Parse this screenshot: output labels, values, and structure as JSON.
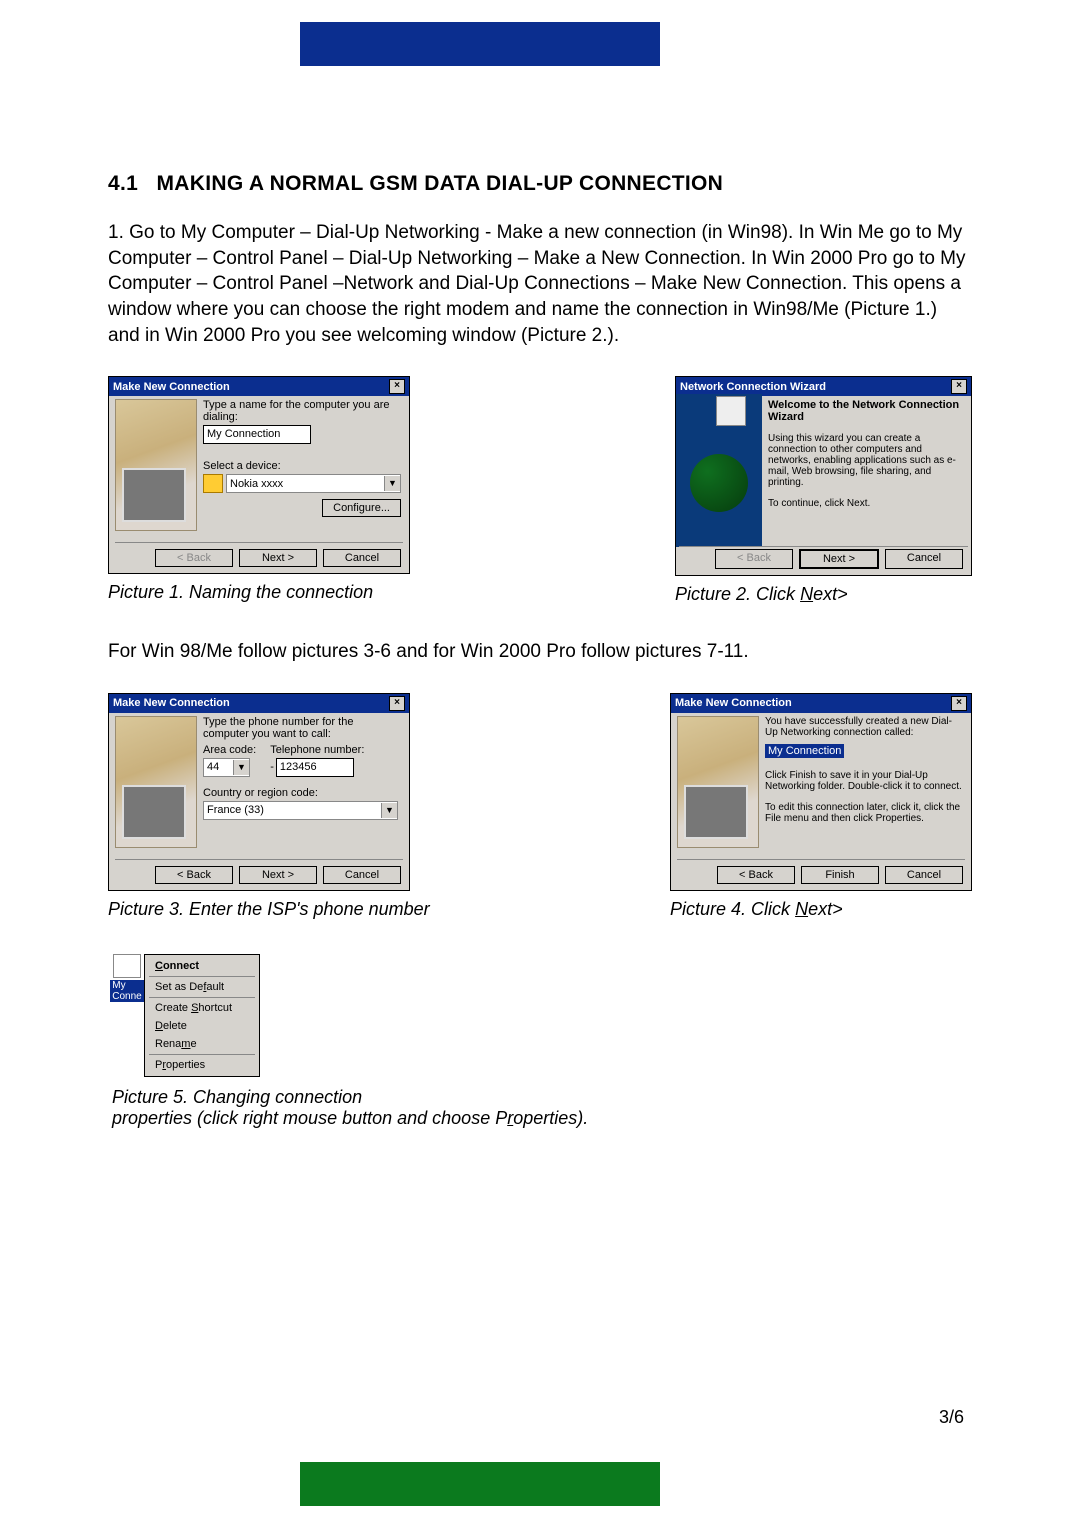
{
  "section": {
    "number": "4.1",
    "title": "MAKING A NORMAL GSM DATA DIAL-UP CONNECTION",
    "intro": "1. Go to My Computer – Dial-Up Networking - Make a new connection (in Win98). In Win Me go to My Computer – Control Panel – Dial-Up Networking – Make a New Connection. In Win 2000 Pro go to My Computer – Control Panel –Network and Dial-Up Connections – Make New Connection. This opens a window where you can choose the right modem and name the connection in Win98/Me (Picture 1.) and in Win 2000 Pro you see welcoming window (Picture 2.).",
    "mid": "For Win 98/Me follow pictures 3-6 and for Win 2000 Pro follow pictures 7-11."
  },
  "buttons": {
    "back": "< Back",
    "next": "Next >",
    "cancel": "Cancel",
    "finish": "Finish"
  },
  "pic1": {
    "window_title": "Make New Connection",
    "label_name": "Type a name for the computer you are dialing:",
    "value_name": "My Connection",
    "label_device": "Select a device:",
    "device": "Nokia xxxx",
    "btn_configure": "Configure...",
    "caption": "Picture 1. Naming the connection"
  },
  "pic2": {
    "window_title": "Network Connection Wizard",
    "heading": "Welcome to the Network Connection Wizard",
    "desc": "Using this wizard you can create a connection to other computers and networks, enabling applications such as e-mail, Web browsing, file sharing, and printing.",
    "continue": "To continue, click Next.",
    "caption_prefix": "Picture 2. Click",
    "caption_underline": "N",
    "caption_suffix": "ext>"
  },
  "pic3": {
    "window_title": "Make New Connection",
    "label_top": "Type the phone number for the computer you want to call:",
    "label_area": "Area code:",
    "area_code": "44",
    "label_tel": "Telephone number:",
    "telephone": "123456",
    "label_country": "Country or region code:",
    "country": "France (33)",
    "caption": "Picture 3. Enter the ISP's phone number"
  },
  "pic4": {
    "window_title": "Make New Connection",
    "line1": "You have successfully created a new Dial-Up Networking connection called:",
    "highlight": "My Connection",
    "line2": "Click Finish to save it in your Dial-Up Networking folder. Double-click it to connect.",
    "line3": "To edit this connection later, click it, click the File menu and then click Properties.",
    "caption_prefix": "Picture 4. Click",
    "caption_underline": "N",
    "caption_suffix": "ext>"
  },
  "pic5": {
    "icon_label": "My Conne",
    "menu": [
      {
        "u": "C",
        "rest": "onnect"
      },
      {
        "pre": "Set as De",
        "u": "f",
        "rest": "ault"
      },
      {
        "pre": "Create ",
        "u": "S",
        "rest": "hortcut"
      },
      {
        "u": "D",
        "rest": "elete"
      },
      {
        "pre": "Rena",
        "u": "m",
        "rest": "e"
      },
      {
        "pre": "P",
        "u": "r",
        "rest": "operties"
      }
    ],
    "caption_l1": "Picture 5. Changing connection",
    "caption_l2a": "properties (click right mouse button and choose P",
    "caption_u": "r",
    "caption_l2b": "operties)."
  },
  "page_number": "3/6"
}
